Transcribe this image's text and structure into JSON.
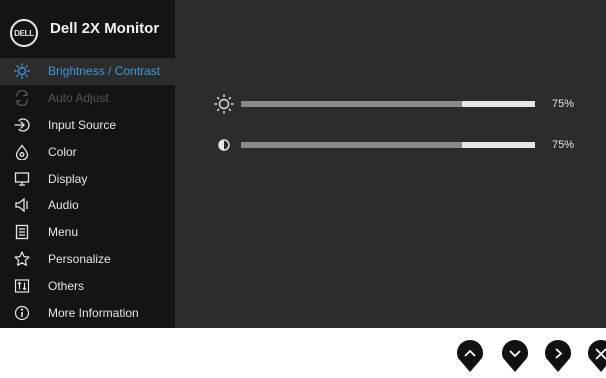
{
  "header": {
    "logo_text": "DELL",
    "title": "Dell 2X Monitor"
  },
  "menu": [
    {
      "label": "Brightness / Contrast",
      "icon": "brightness-icon",
      "state": "active"
    },
    {
      "label": "Auto Adjust",
      "icon": "auto-adjust-icon",
      "state": "disabled"
    },
    {
      "label": "Input Source",
      "icon": "input-source-icon",
      "state": "normal"
    },
    {
      "label": "Color",
      "icon": "color-icon",
      "state": "normal"
    },
    {
      "label": "Display",
      "icon": "display-icon",
      "state": "normal"
    },
    {
      "label": "Audio",
      "icon": "audio-icon",
      "state": "normal"
    },
    {
      "label": "Menu",
      "icon": "menu-icon",
      "state": "normal"
    },
    {
      "label": "Personalize",
      "icon": "personalize-icon",
      "state": "normal"
    },
    {
      "label": "Others",
      "icon": "others-icon",
      "state": "normal"
    },
    {
      "label": "More Information",
      "icon": "info-icon",
      "state": "normal"
    }
  ],
  "settings": {
    "brightness": {
      "icon": "brightness-icon",
      "value": 75,
      "display": "75%"
    },
    "contrast": {
      "icon": "contrast-icon",
      "value": 75,
      "display": "75%"
    }
  },
  "buttons": [
    {
      "name": "up-button",
      "icon": "chevron-up-icon"
    },
    {
      "name": "down-button",
      "icon": "chevron-down-icon"
    },
    {
      "name": "right-button",
      "icon": "chevron-right-icon"
    },
    {
      "name": "exit-button",
      "icon": "close-icon"
    }
  ],
  "colors": {
    "accent": "#3a9ad9",
    "sidebar_bg": "#141414",
    "main_bg": "#2c2c2c",
    "disabled_text": "#555555"
  }
}
